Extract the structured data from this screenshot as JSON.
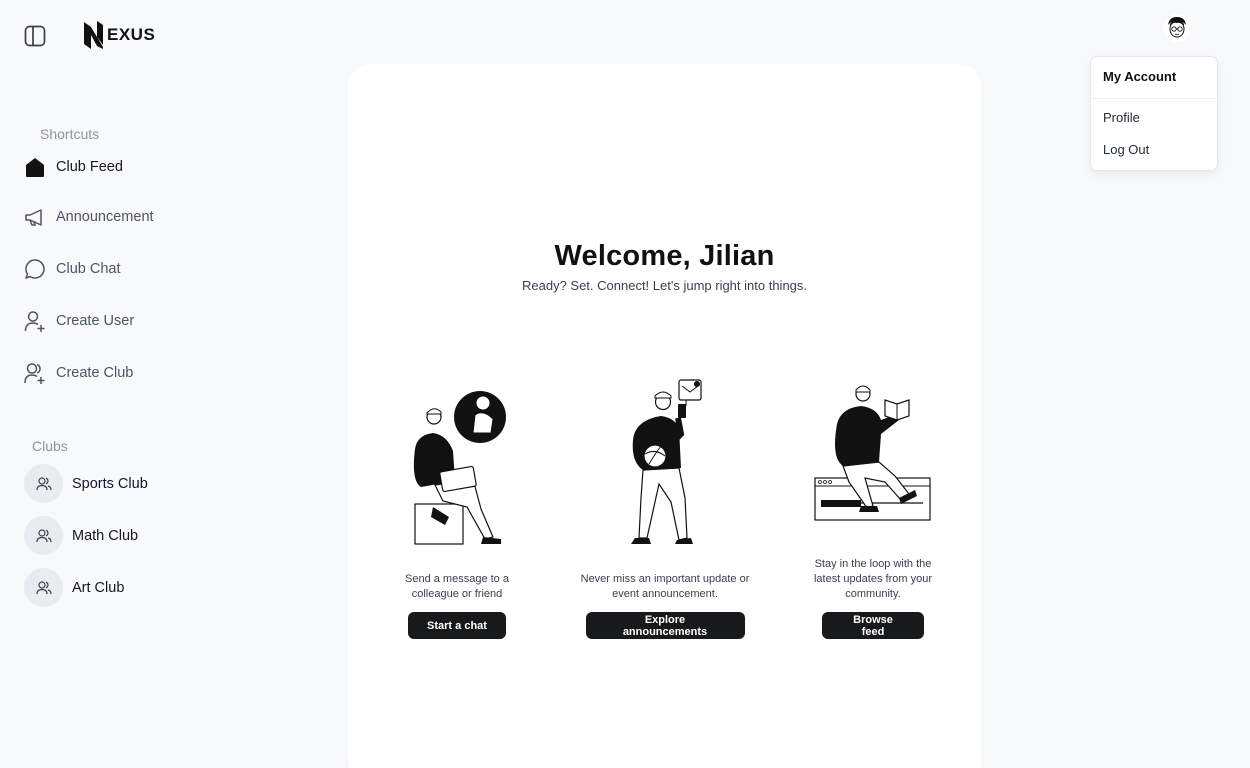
{
  "app": {
    "logo_text": "EXUS"
  },
  "sidebar": {
    "shortcuts_label": "Shortcuts",
    "shortcuts": [
      {
        "label": "Club Feed",
        "icon": "home-icon"
      },
      {
        "label": "Announcement",
        "icon": "megaphone-icon"
      },
      {
        "label": "Club Chat",
        "icon": "chat-icon"
      },
      {
        "label": "Create User",
        "icon": "user-plus-icon"
      },
      {
        "label": "Create Club",
        "icon": "users-plus-icon"
      }
    ],
    "clubs_label": "Clubs",
    "clubs": [
      {
        "label": "Sports Club",
        "icon": "users-icon"
      },
      {
        "label": "Math Club",
        "icon": "users-icon"
      },
      {
        "label": "Art Club",
        "icon": "users-icon"
      }
    ]
  },
  "main": {
    "title": "Welcome, Jilian",
    "subtitle": "Ready? Set. Connect! Let's jump right into things.",
    "features": [
      {
        "text": "Send a message to a colleague or friend",
        "button": "Start a chat"
      },
      {
        "text": "Never miss an important update or event announcement.",
        "button": "Explore announcements"
      },
      {
        "text": "Stay in the loop with the latest updates from your community.",
        "button": "Browse feed"
      }
    ]
  },
  "account_menu": {
    "header": "My Account",
    "items": [
      "Profile",
      "Log Out"
    ]
  },
  "colors": {
    "button_bg": "#18191b",
    "page_bg": "#f8f9fb",
    "card_bg": "#ffffff"
  }
}
